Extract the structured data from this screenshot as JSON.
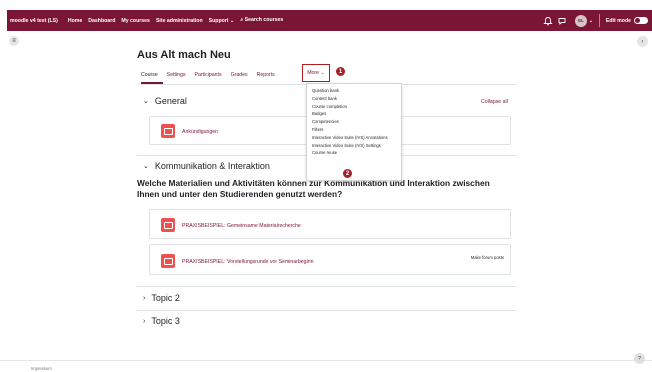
{
  "navbar": {
    "brand": "moodle v4 test (LS)",
    "links": [
      "Home",
      "Dashboard",
      "My courses",
      "Site administration",
      "Support ⌄",
      "⌕ Search courses"
    ],
    "avatar_initials": "GL",
    "edit_mode_label": "Edit mode"
  },
  "course": {
    "title": "Aus Alt mach Neu",
    "tabs": [
      "Course",
      "Settings",
      "Participants",
      "Grades",
      "Reports"
    ],
    "more_label": "More ⌄",
    "badge_1": "1",
    "badge_2": "2"
  },
  "dropdown": {
    "items": [
      "Question bank",
      "Content bank",
      "Course completion",
      "Badges",
      "Competencies",
      "Filters",
      "Interactive Video Suite (IVS) Annotations",
      "Interactive Video Suite (IVS) Settings",
      "Course reuse"
    ]
  },
  "sections": {
    "general": "General",
    "collapse_all": "Collapse all",
    "announcements": "Ankündigungen",
    "kommunikation": "Kommunikation & Interaktion",
    "kommunikation_text": "Welche Materialien und Aktivitäten können zur Kommunikation und Interaktion zwischen Ihnen und unter den Studierenden genutzt werden?",
    "activity_1": "PRAXISBEISPIEL: Gemeinsame Materialrecherche",
    "activity_2": "PRAXISBEISPIEL: Vorstellungsrunde vor Seminarbeginn",
    "make_forum_posts": "Make forum posts",
    "topic2": "Topic 2",
    "topic3": "Topic 3"
  },
  "footer": {
    "text": "Impressum",
    "help": "?"
  },
  "colors": {
    "brand": "#7a1535",
    "highlight": "#b01e1e",
    "activity_icon": "#f0514f"
  }
}
